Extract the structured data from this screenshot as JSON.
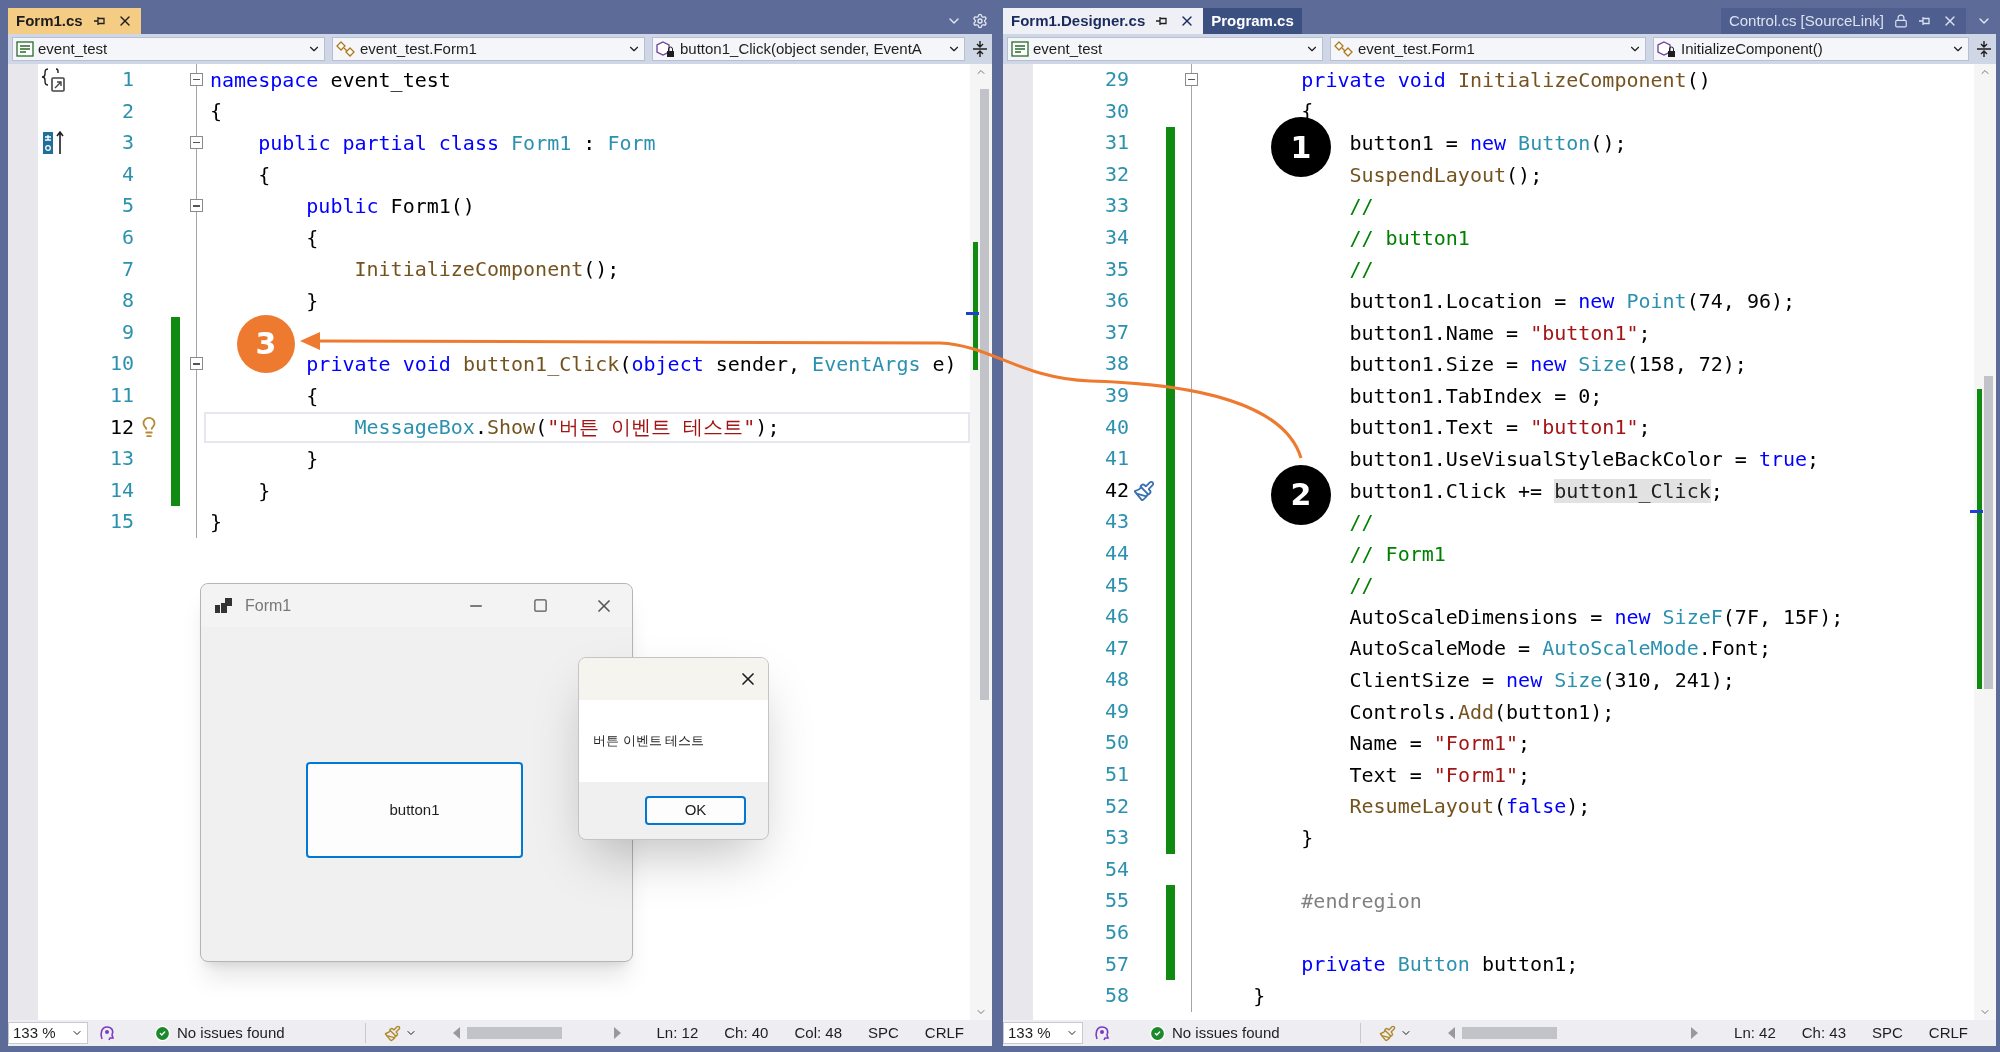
{
  "panes": [
    {
      "focused": true,
      "settings_button": true,
      "tabs": [
        {
          "label": "Form1.cs",
          "kind": "document",
          "selected": true
        }
      ],
      "dropdowns": [
        {
          "kind": "project",
          "text": "event_test"
        },
        {
          "kind": "class",
          "text": "event_test.Form1"
        },
        {
          "kind": "member",
          "text": "button1_Click(object sender, EventA"
        }
      ],
      "lines": [
        {
          "number": "1",
          "changed": false,
          "current": false,
          "fold": true,
          "margin": {
            "kind": "namespace"
          },
          "tokens": [
            {
              "kind": "keyword",
              "text": "namespace"
            },
            {
              "kind": "plain",
              "text": " event_test"
            }
          ]
        },
        {
          "number": "2",
          "changed": false,
          "current": false,
          "tokens": [
            {
              "kind": "plain",
              "text": "{"
            }
          ]
        },
        {
          "number": "3",
          "changed": false,
          "current": false,
          "fold": true,
          "margin": {
            "kind": "class"
          },
          "tokens": [
            {
              "kind": "keyword",
              "text": "    public partial class "
            },
            {
              "kind": "type",
              "text": "Form1"
            },
            {
              "kind": "plain",
              "text": " : "
            },
            {
              "kind": "type",
              "text": "Form"
            }
          ]
        },
        {
          "number": "4",
          "changed": false,
          "current": false,
          "tokens": [
            {
              "kind": "plain",
              "text": "    {"
            }
          ]
        },
        {
          "number": "5",
          "changed": false,
          "current": false,
          "fold": true,
          "tokens": [
            {
              "kind": "keyword",
              "text": "        public"
            },
            {
              "kind": "plain",
              "text": " Form1()"
            }
          ]
        },
        {
          "number": "6",
          "changed": false,
          "current": false,
          "tokens": [
            {
              "kind": "plain",
              "text": "        {"
            }
          ]
        },
        {
          "number": "7",
          "changed": false,
          "current": false,
          "tokens": [
            {
              "kind": "method",
              "text": "            InitializeComponent"
            },
            {
              "kind": "plain",
              "text": "();"
            }
          ]
        },
        {
          "number": "8",
          "changed": false,
          "current": false,
          "tokens": [
            {
              "kind": "plain",
              "text": "        }"
            }
          ]
        },
        {
          "number": "9",
          "changed": true,
          "current": false,
          "badge": {
            "label": "3",
            "color": "#ee7a30"
          }
        },
        {
          "number": "10",
          "changed": true,
          "current": false,
          "fold": true,
          "tokens": [
            {
              "kind": "keyword",
              "text": "        private void "
            },
            {
              "kind": "method",
              "text": "button1_Click"
            },
            {
              "kind": "plain",
              "text": "("
            },
            {
              "kind": "keyword",
              "text": "object"
            },
            {
              "kind": "plain",
              "text": " sender, "
            },
            {
              "kind": "type",
              "text": "EventArgs"
            },
            {
              "kind": "plain",
              "text": " e)"
            }
          ]
        },
        {
          "number": "11",
          "changed": true,
          "current": false,
          "tokens": [
            {
              "kind": "plain",
              "text": "        {"
            }
          ]
        },
        {
          "number": "12",
          "changed": true,
          "current": true,
          "margin": {
            "kind": "lightbulb"
          },
          "tokens": [
            {
              "kind": "type",
              "text": "            MessageBox"
            },
            {
              "kind": "plain",
              "text": "."
            },
            {
              "kind": "method",
              "text": "Show"
            },
            {
              "kind": "plain",
              "text": "("
            },
            {
              "kind": "string",
              "text": "\"버튼 이벤트 테스트\""
            },
            {
              "kind": "plain",
              "text": ");"
            }
          ]
        },
        {
          "number": "13",
          "changed": true,
          "current": false,
          "tokens": [
            {
              "kind": "plain",
              "text": "        }"
            }
          ]
        },
        {
          "number": "14",
          "changed": true,
          "current": false,
          "tokens": [
            {
              "kind": "plain",
              "text": "    }"
            }
          ]
        },
        {
          "number": "15",
          "changed": false,
          "current": false,
          "tokens": [
            {
              "kind": "plain",
              "text": "}"
            }
          ]
        }
      ],
      "status": {
        "zoom": "133 %",
        "issues": "No issues found",
        "position": [
          "Ln: 12",
          "Ch: 40",
          "Col: 48",
          "SPC",
          "CRLF"
        ]
      }
    },
    {
      "focused": false,
      "settings_button": false,
      "tabs": [
        {
          "label": "Form1.Designer.cs",
          "kind": "document",
          "selected": true
        },
        {
          "label": "Program.cs",
          "kind": "document",
          "selected": false
        },
        {
          "label": "Control.cs [SourceLink]",
          "kind": "preview",
          "selected": false
        }
      ],
      "dropdowns": [
        {
          "kind": "project",
          "text": "event_test"
        },
        {
          "kind": "class",
          "text": "event_test.Form1"
        },
        {
          "kind": "member",
          "text": "InitializeComponent()"
        }
      ],
      "lines": [
        {
          "number": "29",
          "changed": false,
          "current": false,
          "fold": true,
          "tokens": [
            {
              "kind": "keyword",
              "text": "        private void "
            },
            {
              "kind": "method",
              "text": "InitializeComponent"
            },
            {
              "kind": "plain",
              "text": "()"
            }
          ]
        },
        {
          "number": "30",
          "changed": false,
          "current": false,
          "tokens": [
            {
              "kind": "plain",
              "text": "        {"
            }
          ]
        },
        {
          "number": "31",
          "changed": true,
          "current": false,
          "badge": {
            "label": "1",
            "color": "#000000"
          },
          "tokens": [
            {
              "kind": "plain",
              "text": "            button1 = "
            },
            {
              "kind": "keyword",
              "text": "new "
            },
            {
              "kind": "type",
              "text": "Button"
            },
            {
              "kind": "plain",
              "text": "();"
            }
          ]
        },
        {
          "number": "32",
          "changed": true,
          "current": false,
          "tokens": [
            {
              "kind": "method",
              "text": "            SuspendLayout"
            },
            {
              "kind": "plain",
              "text": "();"
            }
          ]
        },
        {
          "number": "33",
          "changed": true,
          "current": false,
          "tokens": [
            {
              "kind": "comment",
              "text": "            //"
            }
          ]
        },
        {
          "number": "34",
          "changed": true,
          "current": false,
          "tokens": [
            {
              "kind": "comment",
              "text": "            // button1"
            }
          ]
        },
        {
          "number": "35",
          "changed": true,
          "current": false,
          "tokens": [
            {
              "kind": "comment",
              "text": "            //"
            }
          ]
        },
        {
          "number": "36",
          "changed": true,
          "current": false,
          "tokens": [
            {
              "kind": "plain",
              "text": "            button1.Location = "
            },
            {
              "kind": "keyword",
              "text": "new "
            },
            {
              "kind": "type",
              "text": "Point"
            },
            {
              "kind": "plain",
              "text": "(74, 96);"
            }
          ]
        },
        {
          "number": "37",
          "changed": true,
          "current": false,
          "tokens": [
            {
              "kind": "plain",
              "text": "            button1.Name = "
            },
            {
              "kind": "string",
              "text": "\"button1\""
            },
            {
              "kind": "plain",
              "text": ";"
            }
          ]
        },
        {
          "number": "38",
          "changed": true,
          "current": false,
          "tokens": [
            {
              "kind": "plain",
              "text": "            button1.Size = "
            },
            {
              "kind": "keyword",
              "text": "new "
            },
            {
              "kind": "type",
              "text": "Size"
            },
            {
              "kind": "plain",
              "text": "(158, 72);"
            }
          ]
        },
        {
          "number": "39",
          "changed": true,
          "current": false,
          "tokens": [
            {
              "kind": "plain",
              "text": "            button1.TabIndex = 0;"
            }
          ]
        },
        {
          "number": "40",
          "changed": true,
          "current": false,
          "tokens": [
            {
              "kind": "plain",
              "text": "            button1.Text = "
            },
            {
              "kind": "string",
              "text": "\"button1\""
            },
            {
              "kind": "plain",
              "text": ";"
            }
          ]
        },
        {
          "number": "41",
          "changed": true,
          "current": false,
          "tokens": [
            {
              "kind": "plain",
              "text": "            button1.UseVisualStyleBackColor = "
            },
            {
              "kind": "keyword",
              "text": "true"
            },
            {
              "kind": "plain",
              "text": ";"
            }
          ]
        },
        {
          "number": "42",
          "changed": true,
          "current": true,
          "margin": {
            "kind": "brush"
          },
          "badge": {
            "label": "2",
            "color": "#000000"
          },
          "tokens": [
            {
              "kind": "plain",
              "text": "            button1.Click += "
            },
            {
              "kind": "reference",
              "text": "button1_Click"
            },
            {
              "kind": "plain",
              "text": ";"
            }
          ]
        },
        {
          "number": "43",
          "changed": true,
          "current": false,
          "tokens": [
            {
              "kind": "comment",
              "text": "            //"
            }
          ]
        },
        {
          "number": "44",
          "changed": true,
          "current": false,
          "tokens": [
            {
              "kind": "comment",
              "text": "            // Form1"
            }
          ]
        },
        {
          "number": "45",
          "changed": true,
          "current": false,
          "tokens": [
            {
              "kind": "comment",
              "text": "            //"
            }
          ]
        },
        {
          "number": "46",
          "changed": true,
          "current": false,
          "tokens": [
            {
              "kind": "plain",
              "text": "            AutoScaleDimensions = "
            },
            {
              "kind": "keyword",
              "text": "new "
            },
            {
              "kind": "type",
              "text": "SizeF"
            },
            {
              "kind": "plain",
              "text": "(7F, 15F);"
            }
          ]
        },
        {
          "number": "47",
          "changed": true,
          "current": false,
          "tokens": [
            {
              "kind": "plain",
              "text": "            AutoScaleMode = "
            },
            {
              "kind": "type",
              "text": "AutoScaleMode"
            },
            {
              "kind": "plain",
              "text": ".Font;"
            }
          ]
        },
        {
          "number": "48",
          "changed": true,
          "current": false,
          "tokens": [
            {
              "kind": "plain",
              "text": "            ClientSize = "
            },
            {
              "kind": "keyword",
              "text": "new "
            },
            {
              "kind": "type",
              "text": "Size"
            },
            {
              "kind": "plain",
              "text": "(310, 241);"
            }
          ]
        },
        {
          "number": "49",
          "changed": true,
          "current": false,
          "tokens": [
            {
              "kind": "plain",
              "text": "            Controls."
            },
            {
              "kind": "method",
              "text": "Add"
            },
            {
              "kind": "plain",
              "text": "(button1);"
            }
          ]
        },
        {
          "number": "50",
          "changed": true,
          "current": false,
          "tokens": [
            {
              "kind": "plain",
              "text": "            Name = "
            },
            {
              "kind": "string",
              "text": "\"Form1\""
            },
            {
              "kind": "plain",
              "text": ";"
            }
          ]
        },
        {
          "number": "51",
          "changed": true,
          "current": false,
          "tokens": [
            {
              "kind": "plain",
              "text": "            Text = "
            },
            {
              "kind": "string",
              "text": "\"Form1\""
            },
            {
              "kind": "plain",
              "text": ";"
            }
          ]
        },
        {
          "number": "52",
          "changed": true,
          "current": false,
          "tokens": [
            {
              "kind": "method",
              "text": "            ResumeLayout"
            },
            {
              "kind": "plain",
              "text": "("
            },
            {
              "kind": "keyword",
              "text": "false"
            },
            {
              "kind": "plain",
              "text": ");"
            }
          ]
        },
        {
          "number": "53",
          "changed": true,
          "current": false,
          "tokens": [
            {
              "kind": "plain",
              "text": "        }"
            }
          ]
        },
        {
          "number": "54",
          "changed": false,
          "current": false
        },
        {
          "number": "55",
          "changed": true,
          "current": false,
          "tokens": [
            {
              "kind": "preprocessor",
              "text": "        #endregion"
            }
          ]
        },
        {
          "number": "56",
          "changed": true,
          "current": false
        },
        {
          "number": "57",
          "changed": true,
          "current": false,
          "tokens": [
            {
              "kind": "keyword",
              "text": "        private "
            },
            {
              "kind": "type",
              "text": "Button"
            },
            {
              "kind": "plain",
              "text": " button1;"
            }
          ]
        },
        {
          "number": "58",
          "changed": false,
          "current": false,
          "tokens": [
            {
              "kind": "plain",
              "text": "    }"
            }
          ]
        }
      ],
      "status": {
        "zoom": "133 %",
        "issues": "No issues found",
        "position": [
          "Ln: 42",
          "Ch: 43",
          "SPC",
          "CRLF"
        ]
      }
    }
  ],
  "form_window": {
    "title": "Form1",
    "button": "button1"
  },
  "message_box": {
    "message": "버튼 이벤트 테스트",
    "button": "OK"
  }
}
